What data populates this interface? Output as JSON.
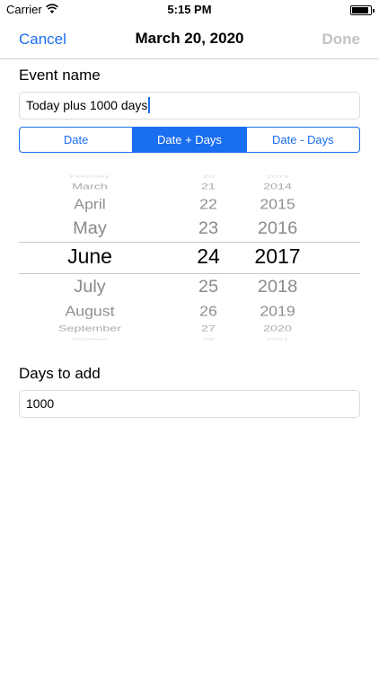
{
  "status_bar": {
    "carrier": "Carrier",
    "time": "5:15 PM",
    "battery_level": 0.9
  },
  "nav": {
    "cancel_label": "Cancel",
    "title": "March 20, 2020",
    "done_label": "Done"
  },
  "event_name": {
    "label": "Event name",
    "value": "Today plus 1000 days"
  },
  "segmented": {
    "options": [
      "Date",
      "Date + Days",
      "Date - Days"
    ],
    "selected_index": 1
  },
  "picker": {
    "months": [
      "February",
      "March",
      "April",
      "May",
      "June",
      "July",
      "August",
      "September",
      "October"
    ],
    "days": [
      "20",
      "21",
      "22",
      "23",
      "24",
      "25",
      "26",
      "27",
      "28"
    ],
    "years": [
      "2013",
      "2014",
      "2015",
      "2016",
      "2017",
      "2018",
      "2019",
      "2020",
      "2021"
    ],
    "selected": {
      "month": "June",
      "day": "24",
      "year": "2017"
    }
  },
  "days_to_add": {
    "label": "Days to add",
    "value": "1000"
  },
  "colors": {
    "accent": "#1a6ef0",
    "disabled": "#c3c3c7"
  }
}
